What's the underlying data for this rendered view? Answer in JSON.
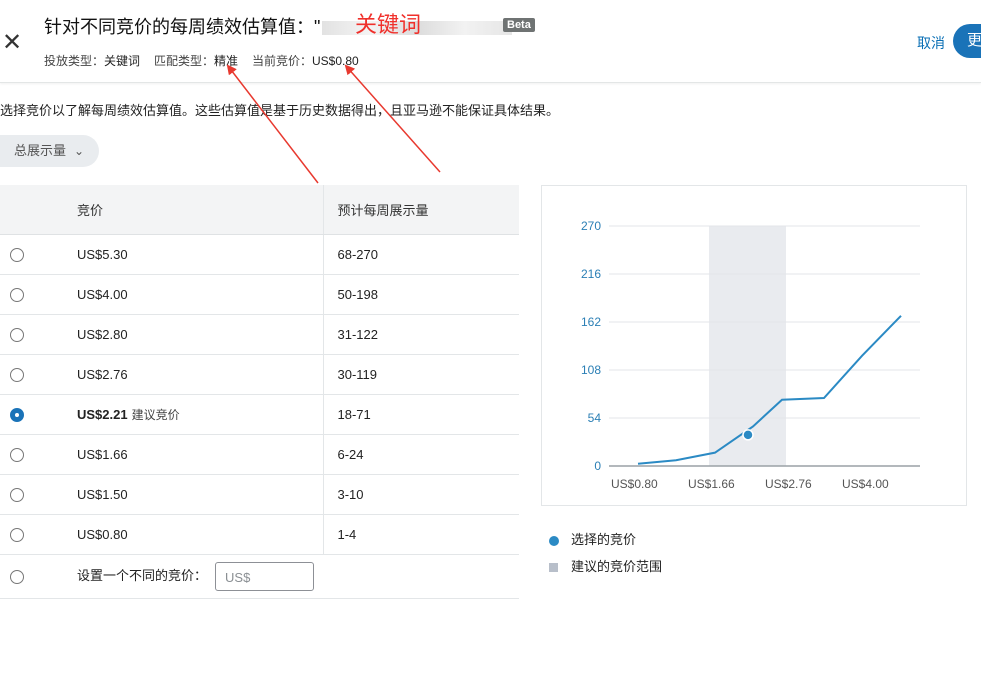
{
  "header": {
    "close_icon": "close-icon",
    "title_prefix": "针对不同竞价的每周绩效估算值：\"",
    "keyword_annotation": "关键词",
    "beta": "Beta",
    "targeting_type_label": "投放类型：",
    "targeting_type_value": "关键词",
    "match_type_label": "匹配类型：",
    "match_type_value": "精准",
    "current_bid_label": "当前竞价：",
    "current_bid_value": "US$0.80",
    "cancel": "取消",
    "primary_button": "更"
  },
  "instruction": "选择竞价以了解每周绩效估算值。这些估算值是基于历史数据得出，且亚马逊不能保证具体结果。",
  "metric_dropdown": {
    "label": "总展示量",
    "icon": "chevron-down-icon"
  },
  "table": {
    "headers": {
      "bid": "竞价",
      "impressions": "预计每周展示量"
    },
    "rows": [
      {
        "bid": "US$5.30",
        "impressions": "68-270",
        "selected": false,
        "tag": ""
      },
      {
        "bid": "US$4.00",
        "impressions": "50-198",
        "selected": false,
        "tag": ""
      },
      {
        "bid": "US$2.80",
        "impressions": "31-122",
        "selected": false,
        "tag": ""
      },
      {
        "bid": "US$2.76",
        "impressions": "30-119",
        "selected": false,
        "tag": ""
      },
      {
        "bid": "US$2.21",
        "impressions": "18-71",
        "selected": true,
        "tag": "建议竞价"
      },
      {
        "bid": "US$1.66",
        "impressions": "6-24",
        "selected": false,
        "tag": ""
      },
      {
        "bid": "US$1.50",
        "impressions": "3-10",
        "selected": false,
        "tag": ""
      },
      {
        "bid": "US$0.80",
        "impressions": "1-4",
        "selected": false,
        "tag": ""
      }
    ],
    "custom_label": "设置一个不同的竞价：",
    "custom_placeholder": "US$"
  },
  "chart_data": {
    "type": "line",
    "x_tick_labels": [
      "US$0.80",
      "US$1.66",
      "US$2.76",
      "US$4.00"
    ],
    "y_tick_labels": [
      "0",
      "54",
      "108",
      "162",
      "216",
      "270"
    ],
    "ylim": [
      0,
      270
    ],
    "xlim": [
      0.8,
      5.3
    ],
    "series": [
      {
        "x": [
          0.8,
          1.5,
          1.66,
          2.21,
          2.76,
          2.8,
          4.0,
          5.3
        ],
        "y": [
          2.5,
          6.5,
          15,
          44.5,
          74.5,
          76.5,
          124,
          169
        ]
      }
    ],
    "selected_point": {
      "x": 2.21,
      "y": 35
    },
    "suggested_range": [
      1.66,
      2.76
    ],
    "colors": {
      "line": "#2b8ac4",
      "band": "#e9ebef",
      "grid": "#e3e6e8",
      "axis_text": "#2b7fb5",
      "x_text": "#555555"
    }
  },
  "legend": {
    "selected": "选择的竞价",
    "range": "建议的竞价范围"
  },
  "annotations": {
    "arrow_color": "#e8392f"
  }
}
